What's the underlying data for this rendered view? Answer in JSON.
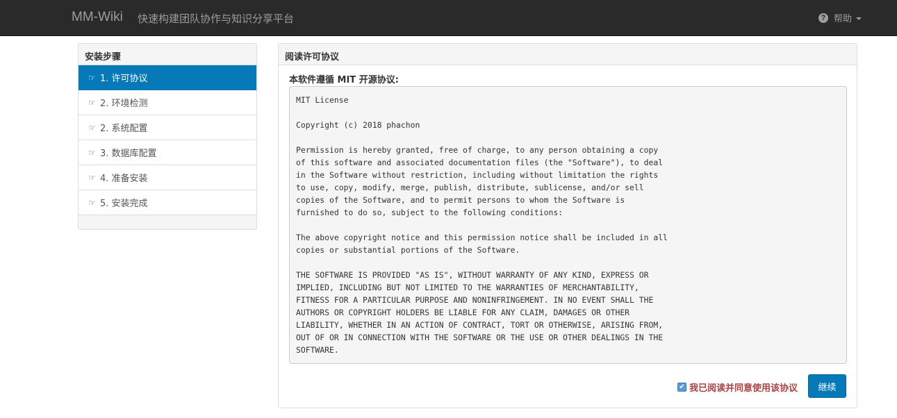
{
  "navbar": {
    "brand": "MM-Wiki",
    "tagline": "快速构建团队协作与知识分享平台",
    "help_label": "帮助",
    "help_icon": "question-circle-icon"
  },
  "sidebar": {
    "heading": "安装步骤",
    "steps": [
      {
        "label": "1. 许可协议",
        "active": true
      },
      {
        "label": "2. 环境检测",
        "active": false
      },
      {
        "label": "2. 系统配置",
        "active": false
      },
      {
        "label": "3. 数据库配置",
        "active": false
      },
      {
        "label": "4. 准备安装",
        "active": false
      },
      {
        "label": "5. 安装完成",
        "active": false
      }
    ]
  },
  "main": {
    "heading": "阅读许可协议",
    "subtitle": "本软件遵循 MIT 开源协议:",
    "license_text": "MIT License\n\nCopyright (c) 2018 phachon\n\nPermission is hereby granted, free of charge, to any person obtaining a copy\nof this software and associated documentation files (the \"Software\"), to deal\nin the Software without restriction, including without limitation the rights\nto use, copy, modify, merge, publish, distribute, sublicense, and/or sell\ncopies of the Software, and to permit persons to whom the Software is\nfurnished to do so, subject to the following conditions:\n\nThe above copyright notice and this permission notice shall be included in all\ncopies or substantial portions of the Software.\n\nTHE SOFTWARE IS PROVIDED \"AS IS\", WITHOUT WARRANTY OF ANY KIND, EXPRESS OR\nIMPLIED, INCLUDING BUT NOT LIMITED TO THE WARRANTIES OF MERCHANTABILITY,\nFITNESS FOR A PARTICULAR PURPOSE AND NONINFRINGEMENT. IN NO EVENT SHALL THE\nAUTHORS OR COPYRIGHT HOLDERS BE LIABLE FOR ANY CLAIM, DAMAGES OR OTHER\nLIABILITY, WHETHER IN AN ACTION OF CONTRACT, TORT OR OTHERWISE, ARISING FROM,\nOUT OF OR IN CONNECTION WITH THE SOFTWARE OR THE USE OR OTHER DEALINGS IN THE\nSOFTWARE.",
    "agree_label": "我已阅读并同意使用该协议",
    "agree_checked": true,
    "continue_label": "继续"
  },
  "colors": {
    "navbar_bg": "#2a2a2a",
    "primary": "#0679b9",
    "agree_text": "#a94442"
  }
}
